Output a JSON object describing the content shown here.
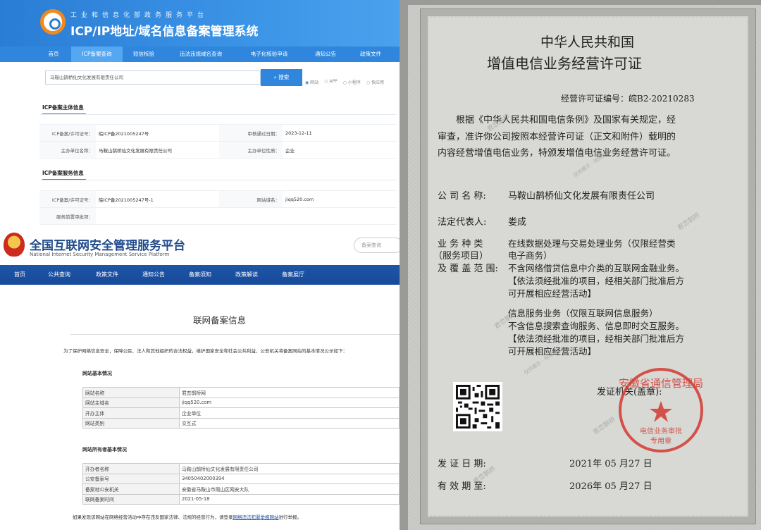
{
  "icp": {
    "header_sub": "工业和信息化部政务服务平台",
    "title": "ICP/IP地址/域名信息备案管理系统",
    "nav": [
      {
        "label": "首页",
        "active": false
      },
      {
        "label": "ICP备案查询",
        "active": true
      },
      {
        "label": "短信核验",
        "active": false
      },
      {
        "label": "违法违规域名查询",
        "active": false
      },
      {
        "label": "电子化核验申请",
        "active": false
      },
      {
        "label": "通知公告",
        "active": false
      },
      {
        "label": "政策文件",
        "active": false
      }
    ],
    "search_value": "马鞍山鹊桥仙文化发展有限责任公司",
    "search_button": "搜索",
    "radios": [
      "网站",
      "APP",
      "小程序",
      "快应用"
    ],
    "main_section": "ICP备案主体信息",
    "main_rows": [
      {
        "k1": "ICP备案/许可证号：",
        "v1": "皖ICP备2021005247号",
        "k2": "审核通过日期：",
        "v2": "2023-12-11"
      },
      {
        "k1": "主办单位名称：",
        "v1": "马鞍山鹊桥仙文化发展有限责任公司",
        "k2": "主办单位性质：",
        "v2": "企业"
      }
    ],
    "service_section": "ICP备案服务信息",
    "service_rows": [
      {
        "k1": "ICP备案/许可证号：",
        "v1": "皖ICP备2021005247号-1",
        "k2": "网站域名：",
        "v2": "jiqq520.com"
      },
      {
        "k1": "服务前置审批项：",
        "v1": "",
        "k2": "",
        "v2": ""
      }
    ]
  },
  "mps": {
    "title": "全国互联网安全管理服务平台",
    "title_en": "National Internet Security Management Service Platform",
    "search_placeholder": "备案查询",
    "nav": [
      "首页",
      "公共查询",
      "政策文件",
      "通知公告",
      "备案须知",
      "政策解读",
      "备案展厅"
    ],
    "card_title": "联网备案信息",
    "intro": "为了保护网络信息安全，保障公民、法人和其他组织的合法权益，维护国家安全和社会公共利益，公安机关将备案网站的基本情况公示如下：",
    "basic_section": "网站基本情况",
    "basic_rows": [
      {
        "k": "网站名称",
        "v": "君恋鹊桥网"
      },
      {
        "k": "网站主域名",
        "v": "jiqq520.com"
      },
      {
        "k": "开办主体",
        "v": "企业单位"
      },
      {
        "k": "网站类别",
        "v": "交互式"
      }
    ],
    "owner_section": "网站所有者基本情况",
    "owner_rows": [
      {
        "k": "开办者名称",
        "v": "马鞍山鹊桥仙文化发展有限责任公司"
      },
      {
        "k": "公安备案号",
        "v": "34050402000394"
      },
      {
        "k": "备案地公安机关",
        "v": "安徽省马鞍山市雨山区网安大队"
      },
      {
        "k": "联网备案时间",
        "v": "2021-05-18"
      }
    ],
    "footer_pre": "如果发现该网站在网络经营活动中存在违反国家法律、法规的经营行为，请登录",
    "footer_link": "网络违法犯罪举报网站",
    "footer_post": "进行举报。"
  },
  "cert": {
    "title_line1": "中华人民共和国",
    "title_line2": "增值电信业务经营许可证",
    "license_no": "经营许可证编号：皖B2-20210283",
    "para1": "根据《中华人民共和国电信条例》及国家有关规定，经",
    "para2": "审查，准许你公司按照本经营许可证（正文和附件）载明的",
    "para3": "内容经营增值电信业务，特颁发增值电信业务经营许可证。",
    "company_label": "公 司 名 称:",
    "company_value": "马鞍山鹊桥仙文化发展有限责任公司",
    "legal_label": "法定代表人:",
    "legal_value": "娄成",
    "scope_label1": "业 务 种 类",
    "scope_label2": "（服务项目）",
    "scope_label3": "及 覆 盖 范 围:",
    "scope_lines": [
      "在线数据处理与交易处理业务（仅限经营类",
      "电子商务）",
      "不含网络借贷信息中介类的互联网金融业务。",
      "【依法须经批准的项目，经相关部门批准后方",
      "可开展相应经营活动】",
      "信息服务业务（仅限互联网信息服务）",
      "不含信息搜索查询服务、信息即时交互服务。",
      "【依法须经批准的项目，经相关部门批准后方",
      "可开展相应经营活动】"
    ],
    "issuer": "发证机关(盖章):",
    "issue_label": "发 证 日 期:",
    "issue_date": "2021年 05 月27  日",
    "valid_label": "有 效 期 至:",
    "valid_date": "2026年 05 月27  日",
    "watermark": "君恋鹊桥",
    "watermark_small": "仅供展示 · 他用无效",
    "seal_text": "安徽省通信管理局",
    "seal_sub": "电信业务审批",
    "seal_sub2": "专用章"
  }
}
